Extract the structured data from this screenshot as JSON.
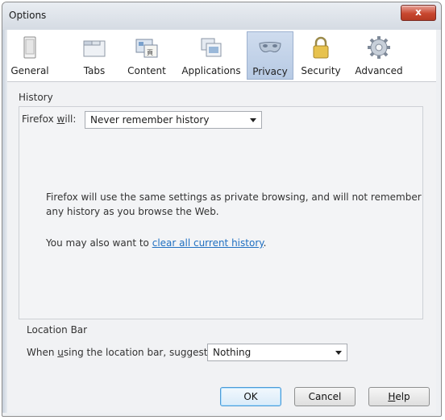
{
  "window": {
    "title": "Options",
    "close_label": "x"
  },
  "toolbar": {
    "items": [
      {
        "label": "General",
        "icon": "general-icon"
      },
      {
        "label": "Tabs",
        "icon": "tabs-icon"
      },
      {
        "label": "Content",
        "icon": "content-icon"
      },
      {
        "label": "Applications",
        "icon": "applications-icon"
      },
      {
        "label": "Privacy",
        "icon": "privacy-mask-icon",
        "selected": true
      },
      {
        "label": "Security",
        "icon": "lock-icon"
      },
      {
        "label": "Advanced",
        "icon": "gear-icon"
      }
    ]
  },
  "history": {
    "section_label": "History",
    "firefox_will_prefix": "Firefox ",
    "firefox_will_u": "w",
    "firefox_will_suffix": "ill:",
    "select_value": "Never remember history",
    "info_line1": "Firefox will use the same settings as private browsing, and will not remember",
    "info_line2": "any history as you browse the Web.",
    "also_prefix": "You may also want to ",
    "also_link": "clear all current history",
    "also_suffix": "."
  },
  "location_bar": {
    "section_label": "Location Bar",
    "suggest_prefix": "When ",
    "suggest_u": "u",
    "suggest_suffix": "sing the location bar, suggest:",
    "select_value": "Nothing"
  },
  "buttons": {
    "ok": "OK",
    "cancel": "Cancel",
    "help_u": "H",
    "help_rest": "elp"
  },
  "colors": {
    "selected_tab_bg": "#c3d3ea",
    "link": "#1f6fc1",
    "close_button": "#c8472f"
  }
}
